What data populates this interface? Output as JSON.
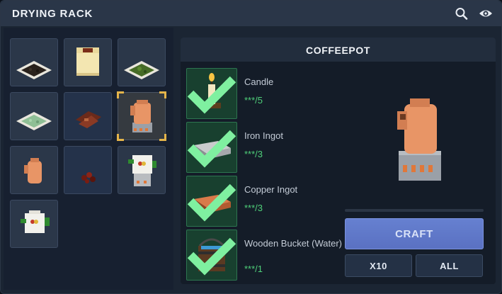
{
  "window": {
    "title": "DRYING RACK"
  },
  "toolbar": {
    "search_icon": "search-icon",
    "visibility_icon": "eye-icon"
  },
  "recipes": [
    {
      "name": "dried-soil-plate-icon"
    },
    {
      "name": "clay-jar-icon"
    },
    {
      "name": "dried-herbs-plate-icon"
    },
    {
      "name": "dried-mint-plate-icon"
    },
    {
      "name": "dried-meat-icon"
    },
    {
      "name": "coffeepot-icon",
      "selected": true
    },
    {
      "name": "copper-pitcher-icon"
    },
    {
      "name": "dried-berries-icon"
    },
    {
      "name": "teapot-on-stove-icon"
    },
    {
      "name": "decorated-teapot-icon"
    }
  ],
  "selected_item": {
    "title": "COFFEEPOT",
    "ingredients": [
      {
        "name": "Candle",
        "qty": "***/5",
        "icon": "candle-icon"
      },
      {
        "name": "Iron Ingot",
        "qty": "***/3",
        "icon": "iron-ingot-icon"
      },
      {
        "name": "Copper Ingot",
        "qty": "***/3",
        "icon": "copper-ingot-icon"
      },
      {
        "name": "Wooden Bucket (Water)",
        "qty": "***/1",
        "icon": "water-bucket-icon"
      }
    ]
  },
  "actions": {
    "craft": "CRAFT",
    "x10": "X10",
    "all": "ALL"
  },
  "colors": {
    "craft_button": "#6680d0",
    "available": "#4fd07a",
    "selection": "#e4b44a"
  }
}
